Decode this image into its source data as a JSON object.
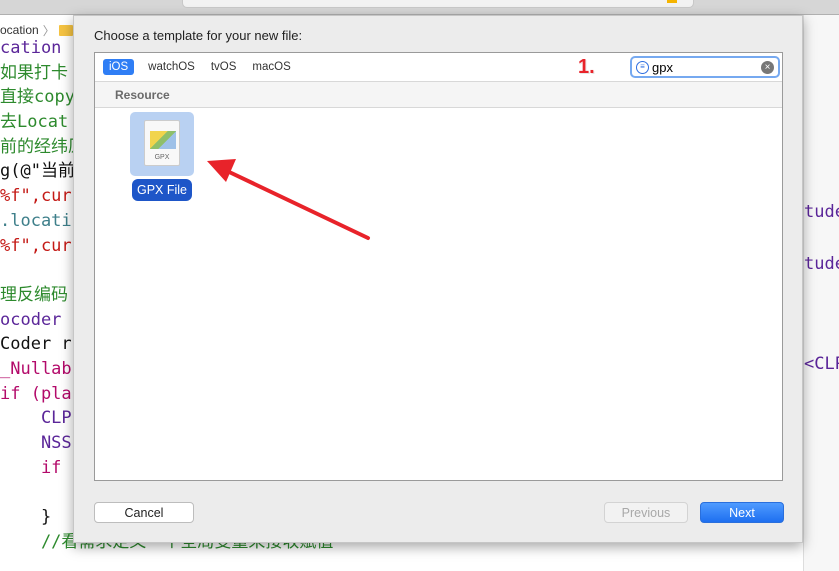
{
  "breadcrumb": {
    "item": "ocation"
  },
  "code_left": [
    {
      "t": "cation",
      "c": "cls"
    },
    {
      "t": "如果打卡",
      "c": "cm"
    },
    {
      "t": "直接copy",
      "c": "cm"
    },
    {
      "t": "去Locat",
      "c": "cm"
    },
    {
      "t": "前的经纬原",
      "c": "cm"
    },
    {
      "t": "g(@\"当前",
      "c": "pl"
    },
    {
      "t": "%f\",cur",
      "c": "str"
    },
    {
      "t": ".locati",
      "c": "prop"
    },
    {
      "t": "%f\",cur",
      "c": "str"
    },
    {
      "t": "",
      "c": "pl"
    },
    {
      "t": "理反编码",
      "c": "cm"
    },
    {
      "t": "ocoder",
      "c": "cls"
    },
    {
      "t": "Coder r",
      "c": "pl"
    },
    {
      "t": "_Nullab",
      "c": "kw"
    },
    {
      "t": "if (pla",
      "c": "kw"
    },
    {
      "t": "    CLP",
      "c": "cls"
    },
    {
      "t": "    NSS",
      "c": "cls"
    },
    {
      "t": "    if",
      "c": "kw"
    },
    {
      "t": "",
      "c": "pl"
    },
    {
      "t": "    }",
      "c": "pl"
    },
    {
      "t": "    //看需求定义一个全局变量来接收赋值",
      "c": "cm"
    }
  ],
  "code_right": [
    "tude",
    "tude",
    "<CLP"
  ],
  "dialog": {
    "title": "Choose a template for your new file:",
    "tabs": [
      {
        "label": "iOS",
        "active": true
      },
      {
        "label": "watchOS"
      },
      {
        "label": "tvOS"
      },
      {
        "label": "macOS"
      }
    ],
    "annotation": "1.",
    "search": {
      "value": "gpx",
      "icon": "filter-icon",
      "clear_icon": "clear-icon"
    },
    "section": "Resource",
    "items": [
      {
        "label": "GPX File",
        "icon_text": "GPX",
        "selected": true
      }
    ],
    "buttons": {
      "cancel": "Cancel",
      "previous": "Previous",
      "next": "Next"
    }
  },
  "colors": {
    "accent": "#2f7ef5",
    "selection": "#1e56c8",
    "annotation": "#e8232a"
  }
}
